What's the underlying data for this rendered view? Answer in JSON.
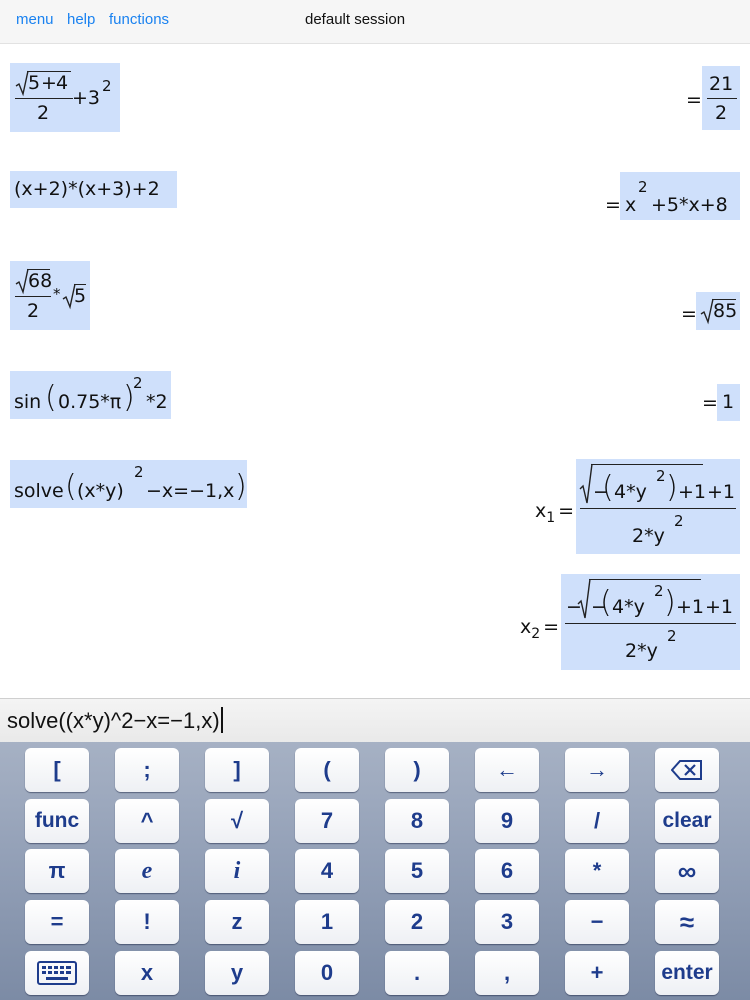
{
  "topbar": {
    "menu": "menu",
    "help": "help",
    "functions": "functions",
    "session_title": "default session"
  },
  "history": [
    {
      "input": {
        "num_a": "5",
        "plus": "+",
        "num_b": "4",
        "den": "2",
        "tail": "+3",
        "exp": "2"
      },
      "result": {
        "eq": "=",
        "num": "21",
        "den": "2"
      }
    },
    {
      "input": {
        "text": "(x+2)*(x+3)+2"
      },
      "result": {
        "eq": "=",
        "base": "x",
        "exp": "2",
        "rest": "+5*x+8"
      }
    },
    {
      "input": {
        "rad": "68",
        "den": "2",
        "times": "*",
        "rad2": "5"
      },
      "result": {
        "eq": "=",
        "rad": "85"
      }
    },
    {
      "input": {
        "fn": "sin",
        "arg": "0.75*π",
        "exp": "2",
        "tail": "*2"
      },
      "result": {
        "eq": "=",
        "value": "1"
      }
    },
    {
      "input": {
        "fn": "solve",
        "inner": "(x*y)",
        "exp": "2",
        "tail": "−x=−1,x"
      },
      "results": [
        {
          "var": "x",
          "sub": "1",
          "eq": "=",
          "pre": "",
          "rad_minus": "−",
          "rad_inner": "4*y",
          "rad_exp": "2",
          "rad_tail": "+1",
          "after": "+1",
          "den": "2*y",
          "den_exp": "2"
        },
        {
          "var": "x",
          "sub": "2",
          "eq": "=",
          "pre": "−",
          "rad_minus": "−",
          "rad_inner": "4*y",
          "rad_exp": "2",
          "rad_tail": "+1",
          "after": "+1",
          "den": "2*y",
          "den_exp": "2"
        }
      ]
    }
  ],
  "input_line": {
    "value": "solve((x*y)^2−x=−1,x)"
  },
  "keyboard": {
    "rows": [
      [
        {
          "label": "["
        },
        {
          "label": ";"
        },
        {
          "label": "]"
        },
        {
          "label": "("
        },
        {
          "label": ")"
        },
        {
          "label": "←"
        },
        {
          "label": "→"
        },
        {
          "label": "⌫",
          "icon": "backspace-icon"
        }
      ],
      [
        {
          "label": "func"
        },
        {
          "label": "^"
        },
        {
          "label": "√"
        },
        {
          "label": "7"
        },
        {
          "label": "8"
        },
        {
          "label": "9"
        },
        {
          "label": "/"
        },
        {
          "label": "clear"
        }
      ],
      [
        {
          "label": "π"
        },
        {
          "label": "e"
        },
        {
          "label": "i"
        },
        {
          "label": "4"
        },
        {
          "label": "5"
        },
        {
          "label": "6"
        },
        {
          "label": "*"
        },
        {
          "label": "∞"
        }
      ],
      [
        {
          "label": "="
        },
        {
          "label": "!"
        },
        {
          "label": "z"
        },
        {
          "label": "1"
        },
        {
          "label": "2"
        },
        {
          "label": "3"
        },
        {
          "label": "−"
        },
        {
          "label": "≈"
        }
      ],
      [
        {
          "label": "⌨",
          "icon": "keyboard-icon"
        },
        {
          "label": "x"
        },
        {
          "label": "y"
        },
        {
          "label": "0"
        },
        {
          "label": "."
        },
        {
          "label": ","
        },
        {
          "label": "+"
        },
        {
          "label": "enter"
        }
      ]
    ]
  },
  "colors": {
    "link": "#1a82f0",
    "math_box": "#cfe0fb",
    "key_text": "#1e3c8c",
    "keyboard_bg": "#93a0b7"
  }
}
